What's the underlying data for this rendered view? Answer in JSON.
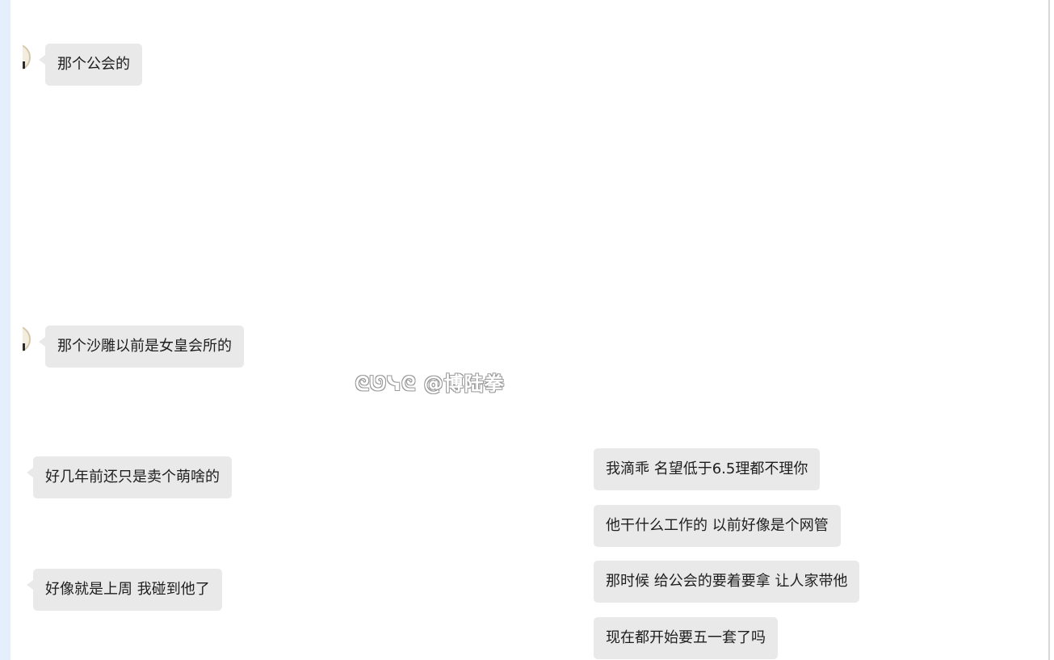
{
  "messages": [
    {
      "text": "那个公会的",
      "side": "left"
    },
    {
      "text": "那个沙雕以前是女皇会所的",
      "side": "left"
    },
    {
      "text": "好几年前还只是卖个萌啥的",
      "side": "left"
    },
    {
      "text": "好像就是上周 我碰到他了",
      "side": "left"
    },
    {
      "text": "我滴乖   名望低于6.5理都不理你",
      "side": "right"
    },
    {
      "text": "他干什么工作的 以前好像是个网管",
      "side": "right"
    },
    {
      "text": "那时候 给公会的要着要拿  让人家带他",
      "side": "right"
    },
    {
      "text": "现在都开始要五一套了吗",
      "side": "right"
    }
  ],
  "watermark": {
    "text": "ᘓᘎᓭᘓ @博陆拳"
  },
  "colors": {
    "bubble": "#e9e9e9",
    "left_strip": "#e4effb",
    "text": "#1e1e1e"
  }
}
